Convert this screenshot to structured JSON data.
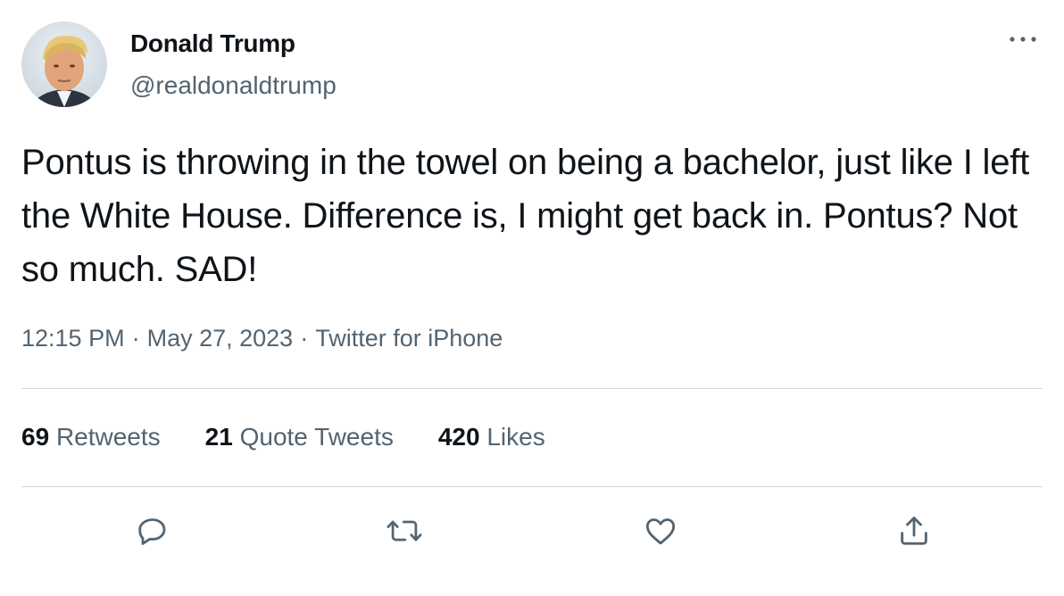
{
  "author": {
    "display_name": "Donald Trump",
    "handle": "@realdonaldtrump"
  },
  "tweet": {
    "text": "Pontus is throwing in the towel on being a bachelor, just like I left the White House. Difference is, I might get back in. Pontus? Not so much. SAD!",
    "time": "12:15 PM",
    "date": "May 27, 2023",
    "source": "Twitter for iPhone",
    "separator": "·"
  },
  "stats": {
    "retweets_count": "69",
    "retweets_label": "Retweets",
    "quotes_count": "21",
    "quotes_label": "Quote Tweets",
    "likes_count": "420",
    "likes_label": "Likes"
  },
  "icons": {
    "more": "more-horizontal-icon",
    "reply": "reply-icon",
    "retweet": "retweet-icon",
    "like": "heart-icon",
    "share": "share-icon"
  },
  "colors": {
    "text_primary": "#0f1419",
    "text_secondary": "#536471",
    "divider": "#cfd9de"
  }
}
